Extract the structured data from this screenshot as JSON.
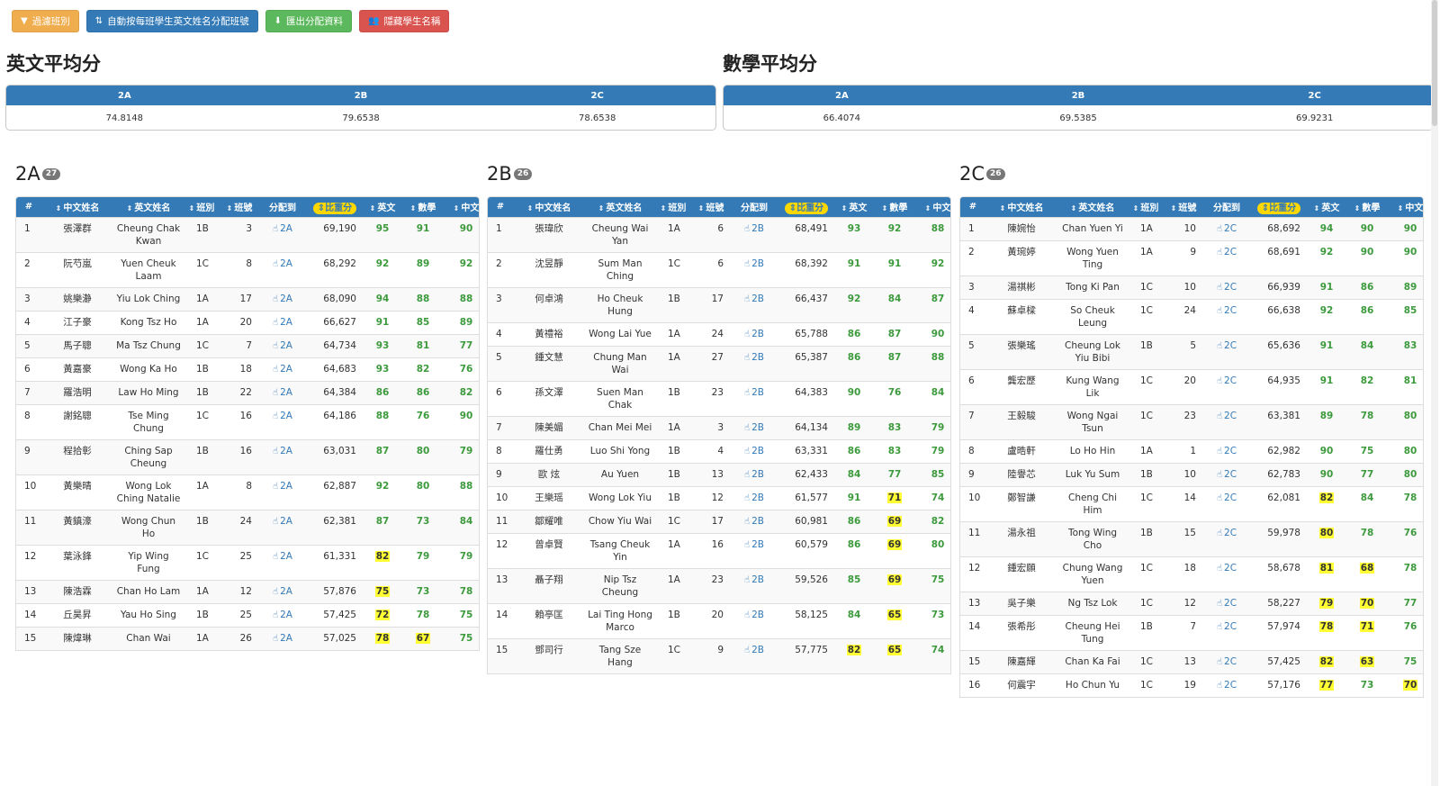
{
  "toolbar": {
    "filter": "過濾班別",
    "auto_assign": "自動按每班學生英文姓名分配班號",
    "export": "匯出分配資料",
    "hide_names": "隱藏學生名稱"
  },
  "english_avg": {
    "title": "英文平均分",
    "classes": [
      "2A",
      "2B",
      "2C"
    ],
    "values": [
      "74.8148",
      "79.6538",
      "78.6538"
    ]
  },
  "math_avg": {
    "title": "數學平均分",
    "classes": [
      "2A",
      "2B",
      "2C"
    ],
    "values": [
      "66.4074",
      "69.5385",
      "69.9231"
    ]
  },
  "headers": [
    "#",
    "中文姓名",
    "英文姓名",
    "班別",
    "班號",
    "分配到",
    "比重分",
    "英文",
    "數學",
    "中文"
  ],
  "groups": [
    {
      "name": "2A",
      "count": "27",
      "rows": [
        [
          "1",
          "張澤群",
          "Cheung Chak Kwan",
          "1B",
          "3",
          "2A",
          "69,190",
          "95",
          "91",
          "90"
        ],
        [
          "2",
          "阮芍嵐",
          "Yuen Cheuk Laam",
          "1C",
          "8",
          "2A",
          "68,292",
          "92",
          "89",
          "92"
        ],
        [
          "3",
          "姚樂瀞",
          "Yiu Lok Ching",
          "1A",
          "17",
          "2A",
          "68,090",
          "94",
          "88",
          "88"
        ],
        [
          "4",
          "江子豪",
          "Kong Tsz Ho",
          "1A",
          "20",
          "2A",
          "66,627",
          "91",
          "85",
          "89"
        ],
        [
          "5",
          "馬子聰",
          "Ma Tsz Chung",
          "1C",
          "7",
          "2A",
          "64,734",
          "93",
          "81",
          "77"
        ],
        [
          "6",
          "黃嘉豪",
          "Wong Ka Ho",
          "1B",
          "18",
          "2A",
          "64,683",
          "93",
          "82",
          "76"
        ],
        [
          "7",
          "羅浩明",
          "Law Ho Ming",
          "1B",
          "22",
          "2A",
          "64,384",
          "86",
          "86",
          "82"
        ],
        [
          "8",
          "謝銘聰",
          "Tse Ming Chung",
          "1C",
          "16",
          "2A",
          "64,186",
          "88",
          "76",
          "90"
        ],
        [
          "9",
          "程拾彰",
          "Ching Sap Cheung",
          "1B",
          "16",
          "2A",
          "63,031",
          "87",
          "80",
          "79"
        ],
        [
          "10",
          "黃樂晴",
          "Wong Lok Ching Natalie",
          "1A",
          "8",
          "2A",
          "62,887",
          "92",
          "80",
          "88"
        ],
        [
          "11",
          "黃鎮濠",
          "Wong Chun Ho",
          "1B",
          "24",
          "2A",
          "62,381",
          "87",
          "73",
          "84"
        ],
        [
          "12",
          "葉泳鋒",
          "Yip Wing Fung",
          "1C",
          "25",
          "2A",
          "61,331",
          "82",
          "79",
          "79"
        ],
        [
          "13",
          "陳浩霖",
          "Chan Ho Lam",
          "1A",
          "12",
          "2A",
          "57,876",
          "75",
          "73",
          "78"
        ],
        [
          "14",
          "丘昊昇",
          "Yau Ho Sing",
          "1B",
          "25",
          "2A",
          "57,425",
          "72",
          "78",
          "75"
        ],
        [
          "15",
          "陳煒琳",
          "Chan Wai",
          "1A",
          "26",
          "2A",
          "57,025",
          "78",
          "67",
          "75"
        ]
      ],
      "hl": [
        [
          11,
          7
        ],
        [
          12,
          7
        ],
        [
          13,
          7
        ],
        [
          14,
          7
        ],
        [
          14,
          8
        ]
      ]
    },
    {
      "name": "2B",
      "count": "26",
      "rows": [
        [
          "1",
          "張瑋欣",
          "Cheung Wai Yan",
          "1A",
          "6",
          "2B",
          "68,491",
          "93",
          "92",
          "88"
        ],
        [
          "2",
          "沈昱靜",
          "Sum Man Ching",
          "1C",
          "6",
          "2B",
          "68,392",
          "91",
          "91",
          "92"
        ],
        [
          "3",
          "何卓鴻",
          "Ho Cheuk Hung",
          "1B",
          "17",
          "2B",
          "66,437",
          "92",
          "84",
          "87"
        ],
        [
          "4",
          "黃禮裕",
          "Wong Lai Yue",
          "1A",
          "24",
          "2B",
          "65,788",
          "86",
          "87",
          "90"
        ],
        [
          "5",
          "鍾文慧",
          "Chung Man Wai",
          "1A",
          "27",
          "2B",
          "65,387",
          "86",
          "87",
          "88"
        ],
        [
          "6",
          "孫文澤",
          "Suen Man Chak",
          "1B",
          "23",
          "2B",
          "64,383",
          "90",
          "76",
          "84"
        ],
        [
          "7",
          "陳美媚",
          "Chan Mei Mei",
          "1A",
          "3",
          "2B",
          "64,134",
          "89",
          "83",
          "79"
        ],
        [
          "8",
          "羅仕勇",
          "Luo Shi Yong",
          "1B",
          "4",
          "2B",
          "63,331",
          "86",
          "83",
          "79"
        ],
        [
          "9",
          "歐 炫",
          "Au Yuen",
          "1B",
          "13",
          "2B",
          "62,433",
          "84",
          "77",
          "85"
        ],
        [
          "10",
          "王樂瑶",
          "Wong Lok Yiu",
          "1B",
          "12",
          "2B",
          "61,577",
          "91",
          "71",
          "74"
        ],
        [
          "11",
          "鄒耀唯",
          "Chow Yiu Wai",
          "1C",
          "17",
          "2B",
          "60,981",
          "86",
          "69",
          "82"
        ],
        [
          "12",
          "曾卓賢",
          "Tsang Cheuk Yin",
          "1A",
          "16",
          "2B",
          "60,579",
          "86",
          "69",
          "80"
        ],
        [
          "13",
          "聶子翔",
          "Nip Tsz Cheung",
          "1A",
          "23",
          "2B",
          "59,526",
          "85",
          "69",
          "75"
        ],
        [
          "14",
          "賴亭匡",
          "Lai Ting Hong Marco",
          "1B",
          "20",
          "2B",
          "58,125",
          "84",
          "65",
          "73"
        ],
        [
          "15",
          "鄧司行",
          "Tang Sze Hang",
          "1C",
          "9",
          "2B",
          "57,775",
          "82",
          "65",
          "74"
        ]
      ],
      "hl": [
        [
          9,
          8
        ],
        [
          10,
          8
        ],
        [
          11,
          8
        ],
        [
          12,
          8
        ],
        [
          13,
          8
        ],
        [
          14,
          7
        ],
        [
          14,
          8
        ]
      ]
    },
    {
      "name": "2C",
      "count": "26",
      "rows": [
        [
          "1",
          "陳婉怡",
          "Chan Yuen Yi",
          "1A",
          "10",
          "2C",
          "68,692",
          "94",
          "90",
          "90"
        ],
        [
          "2",
          "黃琬婷",
          "Wong Yuen Ting",
          "1A",
          "9",
          "2C",
          "68,691",
          "92",
          "90",
          "90"
        ],
        [
          "3",
          "湯祺彬",
          "Tong Ki Pan",
          "1C",
          "10",
          "2C",
          "66,939",
          "91",
          "86",
          "89"
        ],
        [
          "4",
          "蘇卓樑",
          "So Cheuk Leung",
          "1C",
          "24",
          "2C",
          "66,638",
          "92",
          "86",
          "85"
        ],
        [
          "5",
          "張樂瑤",
          "Cheung Lok Yiu Bibi",
          "1B",
          "5",
          "2C",
          "65,636",
          "91",
          "84",
          "83"
        ],
        [
          "6",
          "龔宏歷",
          "Kung Wang Lik",
          "1C",
          "20",
          "2C",
          "64,935",
          "91",
          "82",
          "81"
        ],
        [
          "7",
          "王毅駿",
          "Wong Ngai Tsun",
          "1C",
          "23",
          "2C",
          "63,381",
          "89",
          "78",
          "80"
        ],
        [
          "8",
          "盧晧軒",
          "Lo Ho Hin",
          "1A",
          "1",
          "2C",
          "62,982",
          "90",
          "75",
          "80"
        ],
        [
          "9",
          "陸譽芯",
          "Luk Yu Sum",
          "1B",
          "10",
          "2C",
          "62,783",
          "90",
          "77",
          "80"
        ],
        [
          "10",
          "鄭智謙",
          "Cheng Chi Him",
          "1C",
          "14",
          "2C",
          "62,081",
          "82",
          "84",
          "78"
        ],
        [
          "11",
          "湯永祖",
          "Tong Wing Cho",
          "1B",
          "15",
          "2C",
          "59,978",
          "80",
          "78",
          "76"
        ],
        [
          "12",
          "鍾宏願",
          "Chung Wang Yuen",
          "1C",
          "18",
          "2C",
          "58,678",
          "81",
          "68",
          "78"
        ],
        [
          "13",
          "吳子樂",
          "Ng Tsz Lok",
          "1C",
          "12",
          "2C",
          "58,227",
          "79",
          "70",
          "77"
        ],
        [
          "14",
          "張希彤",
          "Cheung Hei Tung",
          "1B",
          "7",
          "2C",
          "57,974",
          "78",
          "71",
          "76"
        ],
        [
          "15",
          "陳嘉輝",
          "Chan Ka Fai",
          "1C",
          "13",
          "2C",
          "57,425",
          "82",
          "63",
          "75"
        ],
        [
          "16",
          "何震宇",
          "Ho Chun Yu",
          "1C",
          "19",
          "2C",
          "57,176",
          "77",
          "73",
          "70"
        ]
      ],
      "hl": [
        [
          9,
          7
        ],
        [
          10,
          7
        ],
        [
          11,
          7
        ],
        [
          11,
          8
        ],
        [
          12,
          7
        ],
        [
          12,
          8
        ],
        [
          13,
          7
        ],
        [
          13,
          8
        ],
        [
          14,
          7
        ],
        [
          14,
          8
        ],
        [
          15,
          7
        ],
        [
          15,
          9
        ]
      ]
    }
  ]
}
